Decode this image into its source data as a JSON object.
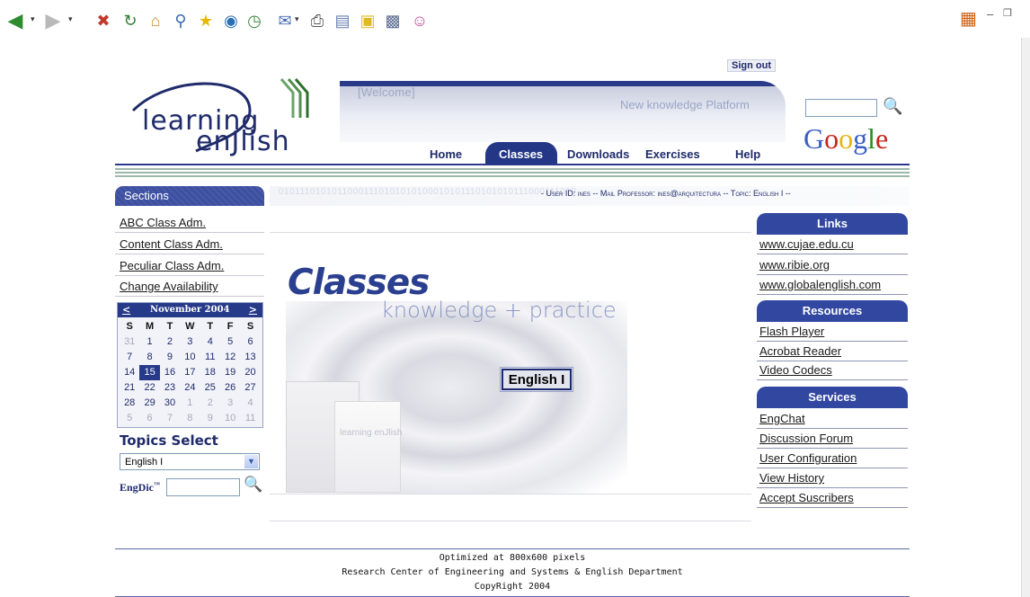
{
  "browser": {
    "toolbar_icons": [
      "back-icon",
      "forward-icon",
      "stop-icon",
      "refresh-icon",
      "home-icon",
      "search-icon",
      "favorites-icon",
      "media-icon",
      "history-icon",
      "mail-icon",
      "print-icon",
      "edit-icon",
      "discuss-icon",
      "research-icon",
      "messenger-icon"
    ],
    "window_controls": [
      "minimize",
      "restore"
    ]
  },
  "header": {
    "welcome": "[Welcome]",
    "sign_out": "Sign out",
    "tagline": "New knowledge Platform",
    "logo_line1": "learning",
    "logo_line2": "enJlish"
  },
  "nav": {
    "items": [
      "Home",
      "Classes",
      "Downloads",
      "Exercises",
      "Help"
    ],
    "active": "Classes"
  },
  "google": {
    "logo": "Google",
    "input_value": ""
  },
  "sections": {
    "title": "Sections",
    "binary_decoration": "01011101010110001110101010100010101110101010111000111010",
    "user_line": "- User ID: ines -- Mail Professor: ines@arquitectura -- Topic: English I --"
  },
  "left_nav": {
    "items": [
      "ABC Class Adm.",
      "Content Class Adm.",
      "Peculiar Class Adm.",
      "Change Availability"
    ]
  },
  "calendar": {
    "prev": "<",
    "next": ">",
    "month": "November 2004",
    "days_of_week": [
      "S",
      "M",
      "T",
      "W",
      "T",
      "F",
      "S"
    ],
    "weeks": [
      [
        "31",
        "1",
        "2",
        "3",
        "4",
        "5",
        "6"
      ],
      [
        "7",
        "8",
        "9",
        "10",
        "11",
        "12",
        "13"
      ],
      [
        "14",
        "15",
        "16",
        "17",
        "18",
        "19",
        "20"
      ],
      [
        "21",
        "22",
        "23",
        "24",
        "25",
        "26",
        "27"
      ],
      [
        "28",
        "29",
        "30",
        "1",
        "2",
        "3",
        "4"
      ],
      [
        "5",
        "6",
        "7",
        "8",
        "9",
        "10",
        "11"
      ]
    ],
    "selected": "15"
  },
  "topics": {
    "title": "Topics Select",
    "selected": "English I"
  },
  "engdic": {
    "label": "EngDic",
    "value": ""
  },
  "center": {
    "title": "Classes",
    "subtitle": "knowledge + practice",
    "box_text": "learning enJlish",
    "english_button": "English I"
  },
  "right": {
    "links_title": "Links",
    "links": [
      "www.cujae.edu.cu",
      "www.ribie.org",
      "www.globalenglish.com"
    ],
    "resources_title": "Resources",
    "resources": [
      "Flash Player",
      "Acrobat Reader",
      "Video Codecs"
    ],
    "services_title": "Services",
    "services": [
      "EngChat",
      "Discussion Forum",
      "User Configuration",
      "View History",
      "Accept Suscribers"
    ]
  },
  "footer": {
    "line1": "Optimized at 800x600 pixels",
    "line2": "Research Center of Engineering and Systems & English Department",
    "line3": "CopyRight 2004"
  },
  "colors": {
    "brand_navy": "#243787",
    "link_text": "#1a1a1a",
    "header_band": "#2a3a88"
  }
}
